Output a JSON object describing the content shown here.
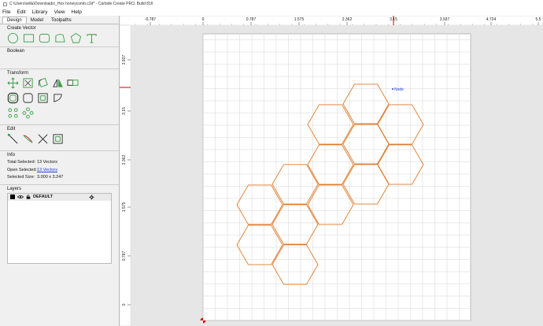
{
  "window": {
    "title": "C:\\Users\\willa\\Downloads\\_Hex honeycomb.c2d* - Carbide Create PRO, Build 816"
  },
  "menu": {
    "file": "File",
    "edit": "Edit",
    "library": "Library",
    "view": "View",
    "help": "Help"
  },
  "tabs": {
    "design": "Design",
    "model": "Model",
    "toolpaths": "Toolpaths"
  },
  "sections": {
    "create_vector": "Create Vector",
    "boolean": "Boolean",
    "transform": "Transform",
    "edit": "Edit",
    "info": "Info",
    "layers": "Layers"
  },
  "info": {
    "total_selected_label": "Total Selected:",
    "total_selected_value": "13 Vectors",
    "open_selected_label": "Open Selected:",
    "open_selected_value": "13 Vectors",
    "selected_size_label": "Selected Size:",
    "selected_size_value": "3.000 x 3.247"
  },
  "layers": [
    {
      "name": "DEFAULT",
      "color": "#000000"
    }
  ],
  "ruler": {
    "top_ticks": [
      "-0.787",
      "0",
      "0.787",
      "1.575",
      "2.362",
      "3.15",
      "3.937",
      "4.724",
      "5.5"
    ],
    "left_ticks": [
      "3.937",
      "3.15",
      "2.362",
      "1.575",
      "0.787",
      "0"
    ]
  },
  "canvas": {
    "node_label": "Node",
    "vector_color": "#e07a2a",
    "marker_color": "#cc0000"
  }
}
